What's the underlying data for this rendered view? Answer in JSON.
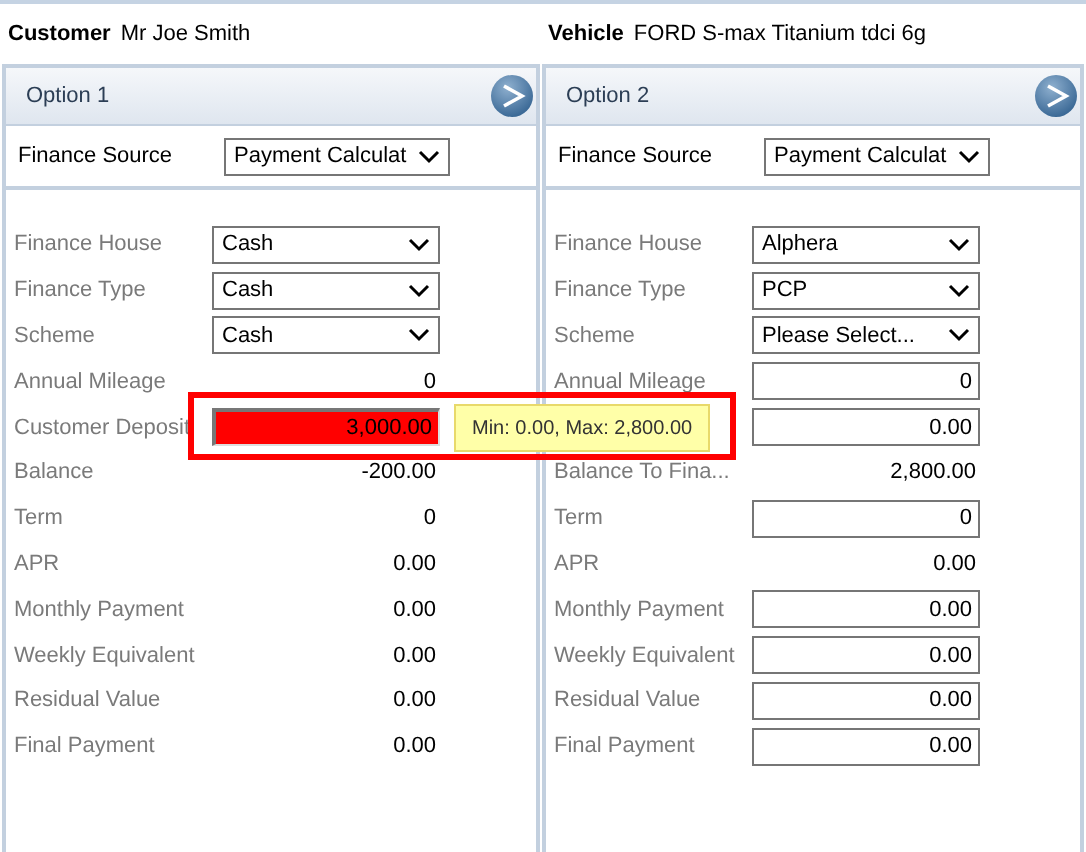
{
  "header": [
    {
      "label": "Customer",
      "value": "Mr Joe Smith"
    },
    {
      "label": "Vehicle",
      "value": "FORD S-max Titanium tdci 6g"
    }
  ],
  "options": [
    {
      "title": "Option 1",
      "source": {
        "label": "Finance Source",
        "value": "Payment Calculat"
      },
      "rows": [
        {
          "kind": "select",
          "label": "Finance House",
          "value": "Cash"
        },
        {
          "kind": "select",
          "label": "Finance Type",
          "value": "Cash"
        },
        {
          "kind": "select",
          "label": "Scheme",
          "value": "Cash"
        },
        {
          "kind": "text",
          "label": "Annual Mileage",
          "value": "0"
        },
        {
          "kind": "input",
          "label": "Customer Deposit",
          "value": "3,000.00",
          "error": true,
          "highlighted": true,
          "tooltip": "Min: 0.00, Max: 2,800.00"
        },
        {
          "kind": "text",
          "label": "Balance",
          "value": "-200.00"
        },
        {
          "kind": "text",
          "label": "Term",
          "value": "0"
        },
        {
          "kind": "text",
          "label": "APR",
          "value": "0.00"
        },
        {
          "kind": "text",
          "label": "Monthly Payment",
          "value": "0.00"
        },
        {
          "kind": "text",
          "label": "Weekly Equivalent",
          "value": "0.00"
        },
        {
          "kind": "text",
          "label": "Residual Value",
          "value": "0.00"
        },
        {
          "kind": "text",
          "label": "Final Payment",
          "value": "0.00"
        }
      ]
    },
    {
      "title": "Option 2",
      "source": {
        "label": "Finance Source",
        "value": "Payment Calculat"
      },
      "rows": [
        {
          "kind": "select",
          "label": "Finance House",
          "value": "Alphera"
        },
        {
          "kind": "select",
          "label": "Finance Type",
          "value": "PCP"
        },
        {
          "kind": "select",
          "label": "Scheme",
          "value": "Please Select..."
        },
        {
          "kind": "input",
          "label": "Annual Mileage",
          "value": "0"
        },
        {
          "kind": "input",
          "value": "0.00"
        },
        {
          "kind": "text",
          "label": "Balance To Fina...",
          "value": "2,800.00"
        },
        {
          "kind": "input",
          "label": "Term",
          "value": "0"
        },
        {
          "kind": "text",
          "label": "APR",
          "value": "0.00"
        },
        {
          "kind": "input",
          "label": "Monthly Payment",
          "value": "0.00"
        },
        {
          "kind": "input",
          "label": "Weekly Equivalent",
          "value": "0.00"
        },
        {
          "kind": "input",
          "label": "Residual Value",
          "value": "0.00"
        },
        {
          "kind": "input",
          "label": "Final Payment",
          "value": "0.00"
        }
      ]
    }
  ]
}
